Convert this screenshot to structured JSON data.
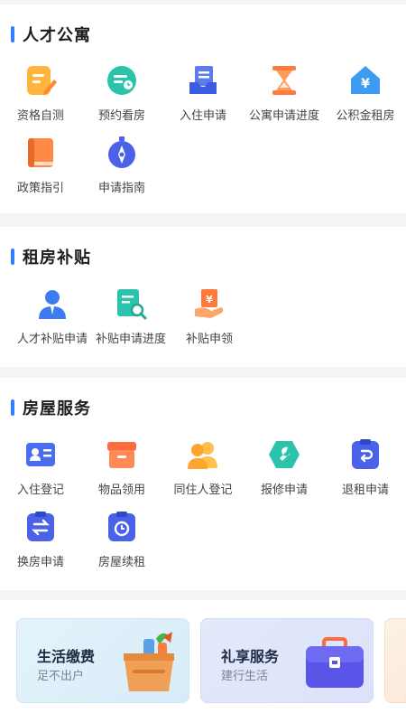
{
  "sections": [
    {
      "title": "人才公寓",
      "items": [
        {
          "label": "资格自测",
          "icon": "edit-document-icon"
        },
        {
          "label": "预约看房",
          "icon": "appointment-icon"
        },
        {
          "label": "入住申请",
          "icon": "inbox-document-icon"
        },
        {
          "label": "公寓申请进度",
          "icon": "hourglass-icon"
        },
        {
          "label": "公积金租房",
          "icon": "yuan-house-icon"
        },
        {
          "label": "政策指引",
          "icon": "book-icon"
        },
        {
          "label": "申请指南",
          "icon": "compass-icon"
        }
      ]
    },
    {
      "title": "租房补贴",
      "items": [
        {
          "label": "人才补贴申请",
          "icon": "person-icon"
        },
        {
          "label": "补贴申请进度",
          "icon": "document-search-icon"
        },
        {
          "label": "补贴申领",
          "icon": "hand-money-icon"
        }
      ]
    },
    {
      "title": "房屋服务",
      "items": [
        {
          "label": "入住登记",
          "icon": "id-card-icon"
        },
        {
          "label": "物品领用",
          "icon": "box-icon"
        },
        {
          "label": "同住人登记",
          "icon": "people-icon"
        },
        {
          "label": "报修申请",
          "icon": "wrench-icon"
        },
        {
          "label": "退租申请",
          "icon": "clipboard-return-icon"
        },
        {
          "label": "换房申请",
          "icon": "exchange-icon"
        },
        {
          "label": "房屋续租",
          "icon": "clipboard-clock-icon"
        }
      ]
    }
  ],
  "cards": [
    {
      "title": "生活缴费",
      "subtitle": "足不出户",
      "icon": "grocery-basket-icon"
    },
    {
      "title": "礼享服务",
      "subtitle": "建行生活",
      "icon": "briefcase-icon"
    }
  ]
}
